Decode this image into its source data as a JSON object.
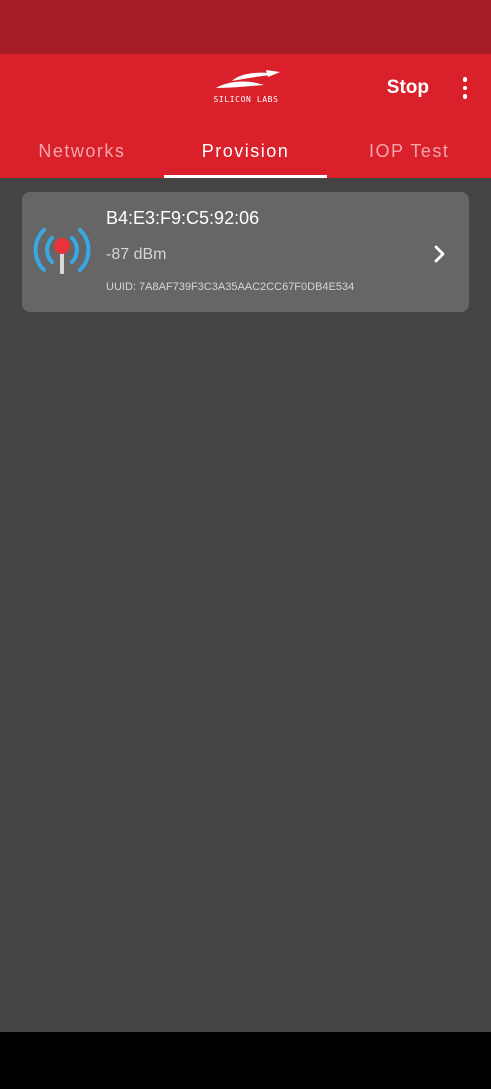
{
  "app_bar": {
    "logo_text": "SILICON LABS",
    "stop_label": "Stop"
  },
  "tabs": [
    {
      "label": "Networks",
      "active": false
    },
    {
      "label": "Provision",
      "active": true
    },
    {
      "label": "IOP Test",
      "active": false
    }
  ],
  "device": {
    "name": "B4:E3:F9:C5:92:06",
    "rssi": "-87 dBm",
    "uuid": "UUID: 7A8AF739F3C3A35AAC2CC67F0DB4E534"
  },
  "colors": {
    "status_bar": "#A51D24",
    "primary": "#D9202B",
    "background": "#444444",
    "card": "#666666",
    "signal_blue": "#3BA8E6",
    "signal_red": "#E8333A"
  },
  "icons": {
    "overflow": "more-vert-icon",
    "device": "signal-antenna-icon",
    "open": "chevron-right-icon"
  }
}
